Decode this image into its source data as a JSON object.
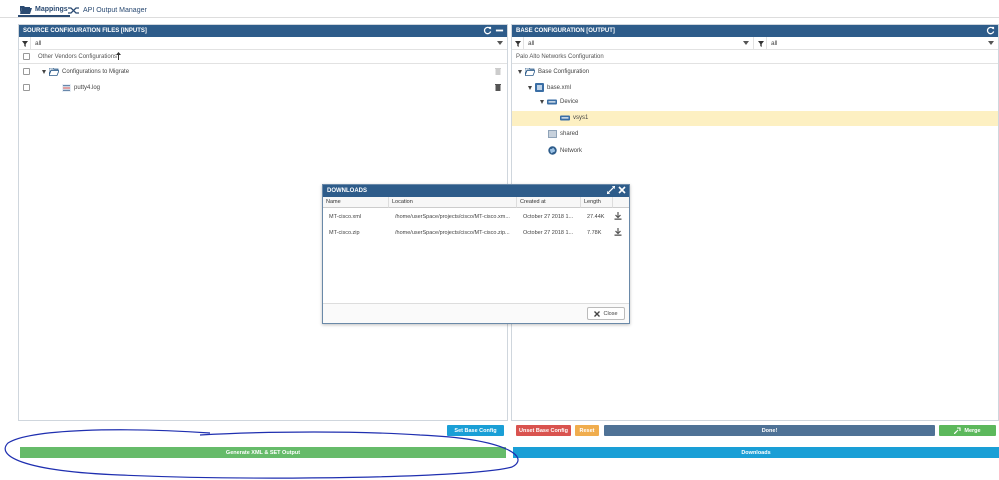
{
  "tabs": [
    {
      "label": "Mappings",
      "icon": "folder-open-icon",
      "active": true
    },
    {
      "label": "API Output Manager",
      "icon": "shuffle-icon",
      "active": false
    }
  ],
  "left_panel": {
    "title": "SOURCE CONFIGURATION FILES [INPUTS]",
    "filter": "all",
    "column": "Other Vendors Configurations",
    "tree": [
      {
        "label": "Configurations to Migrate"
      },
      {
        "label": "putty4.log"
      }
    ],
    "set_base_label": "Set Base Config",
    "generate_label": "Generate XML & SET Output"
  },
  "right_panel": {
    "title": "BASE CONFIGURATION [OUTPUT]",
    "filter1": "all",
    "filter2": "all",
    "column": "Palo Alto Networks Configuration",
    "tree": [
      {
        "label": "Base Configuration"
      },
      {
        "label": "base.xml"
      },
      {
        "label": "Device"
      },
      {
        "label": "vsys1"
      },
      {
        "label": "shared"
      },
      {
        "label": "Network"
      }
    ],
    "unset_label": "Unset Base Config",
    "reset_label": "Reset",
    "done_label": "Done!",
    "merge_label": "Merge",
    "downloads_label": "Downloads"
  },
  "dialog": {
    "title": "DOWNLOADS",
    "columns": [
      "Name",
      "Location",
      "Created at",
      "Length"
    ],
    "rows": [
      {
        "name": "MT-cisco.xml",
        "location": "/home/userSpace/projects/cisco/MT-cisco.xm...",
        "created": "October 27 2018 1...",
        "length": "27.44K"
      },
      {
        "name": "MT-cisco.zip",
        "location": "/home/userSpace/projects/cisco/MT-cisco.zip...",
        "created": "October 27 2018 1...",
        "length": "7.78K"
      }
    ],
    "close_label": "Close"
  },
  "colors": {
    "header": "#2e5c8a",
    "blue_btn": "#1a9fd6",
    "red_btn": "#d9534f",
    "yellow_btn": "#f0ad4e",
    "slate_btn": "#4f7296",
    "green_btn": "#5cb85c",
    "green_bar": "#66bb6a",
    "selected": "#fdf0c2",
    "annotation": "#1f2fb0"
  }
}
